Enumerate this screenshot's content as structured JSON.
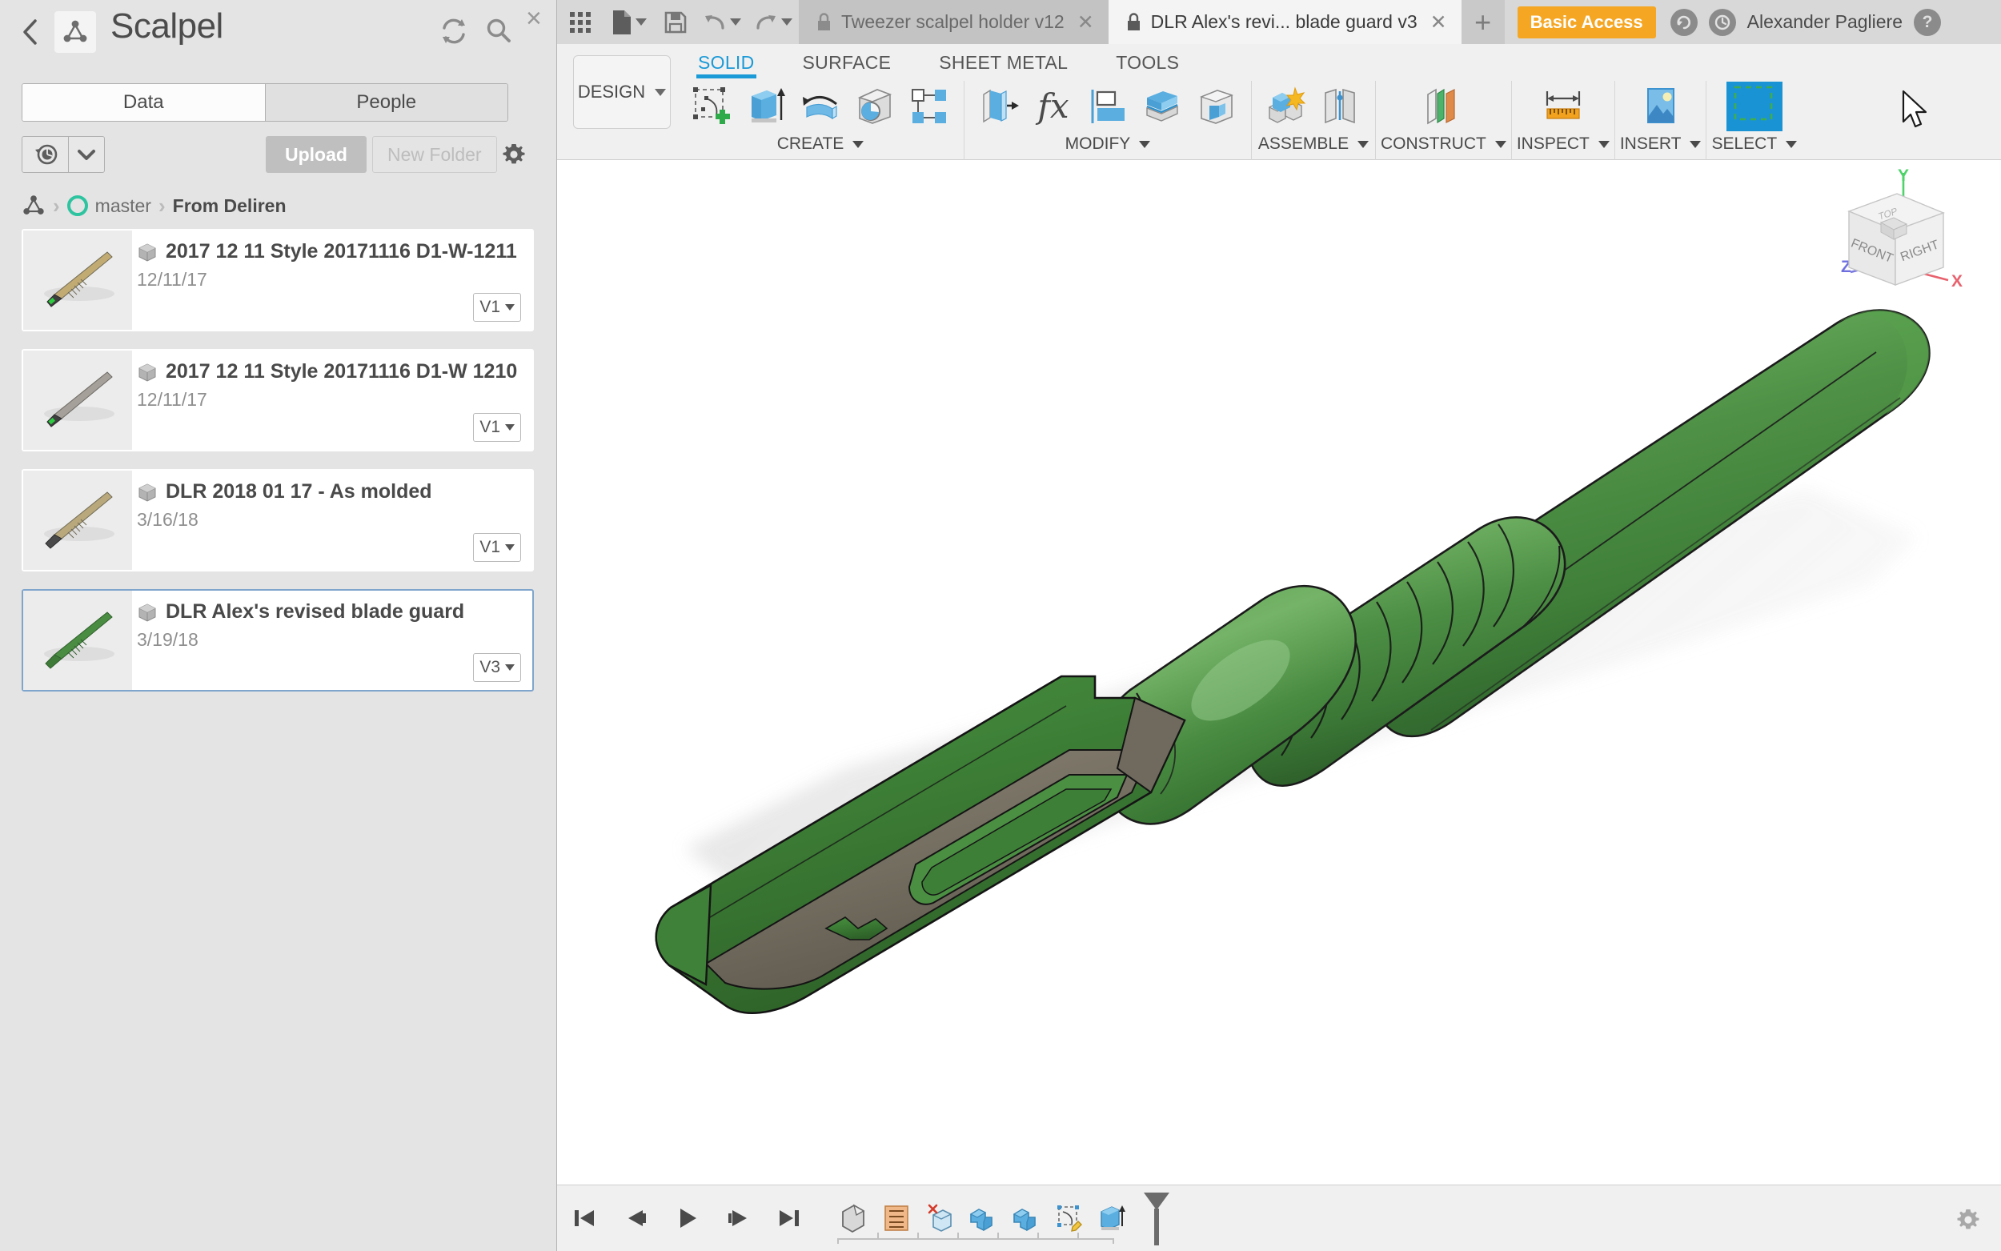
{
  "data_panel": {
    "title": "Scalpel",
    "back_label": "‹",
    "close_label": "×",
    "tabs": [
      {
        "label": "Data",
        "active": true
      },
      {
        "label": "People",
        "active": false
      }
    ],
    "toolbar": {
      "upload_label": "Upload",
      "new_folder_label": "New Folder"
    },
    "breadcrumb": {
      "project_label": "master",
      "folder_label": "From Deliren"
    },
    "items": [
      {
        "name": "2017 12 11 Style 20171116 D1-W-1211",
        "date": "12/11/17",
        "version": "V1",
        "selected": false,
        "thumb_color": "#c2ab73"
      },
      {
        "name": "2017 12 11 Style 20171116 D1-W 1210",
        "date": "12/11/17",
        "version": "V1",
        "selected": false,
        "thumb_color": "#a5a09a"
      },
      {
        "name": "DLR 2018 01 17 - As molded",
        "date": "3/16/18",
        "version": "V1",
        "selected": false,
        "thumb_color": "#b9a87c"
      },
      {
        "name": "DLR Alex's revised blade guard",
        "date": "3/19/18",
        "version": "V3",
        "selected": true,
        "thumb_color": "#4a8c42"
      }
    ]
  },
  "topbar": {
    "doc_tabs": [
      {
        "label": "Tweezer scalpel holder v12",
        "active": false,
        "close": "✕"
      },
      {
        "label": "DLR Alex's revi... blade guard v3",
        "active": true,
        "close": "✕"
      }
    ],
    "new_tab_label": "+",
    "access_badge": "Basic Access",
    "username": "Alexander Pagliere",
    "help_label": "?",
    "notify_label": "↻",
    "jobs_label": "◔"
  },
  "ribbon": {
    "design_label": "DESIGN",
    "tabs": [
      {
        "label": "SOLID",
        "active": true
      },
      {
        "label": "SURFACE",
        "active": false
      },
      {
        "label": "SHEET METAL",
        "active": false
      },
      {
        "label": "TOOLS",
        "active": false
      }
    ],
    "groups": [
      {
        "label": "CREATE",
        "icons": [
          "sketch-icon",
          "extrude-icon",
          "revolve-icon",
          "hole-icon",
          "pattern-icon"
        ]
      },
      {
        "label": "MODIFY",
        "icons": [
          "press-pull-icon",
          "fx-parameters-icon",
          "align-icon",
          "shell-icon",
          "split-body-icon"
        ]
      },
      {
        "label": "ASSEMBLE",
        "icons": [
          "new-component-icon",
          "joint-icon"
        ]
      },
      {
        "label": "CONSTRUCT",
        "icons": [
          "offset-plane-icon"
        ]
      },
      {
        "label": "INSPECT",
        "icons": [
          "measure-icon"
        ]
      },
      {
        "label": "INSERT",
        "icons": [
          "insert-image-icon"
        ]
      },
      {
        "label": "SELECT",
        "icons": [
          "select-window-icon"
        ]
      }
    ]
  },
  "canvas": {
    "viewcube": {
      "front_label": "FRONT",
      "right_label": "RIGHT",
      "top_label": "TOP",
      "axis_x": "X",
      "axis_y": "Y",
      "axis_z": "Z",
      "axis_x_color": "#e8626e",
      "axis_y_color": "#4ed36a",
      "axis_z_color": "#6f6fe0"
    },
    "model": {
      "name": "scalpel-handle-with-blade-guard",
      "body_color": "#4a8c42",
      "body_shade_dark": "#2f5f2c",
      "body_shade_light": "#6aa95f",
      "blade_color": "#7a7466",
      "shadow_color": "#d4d4d4"
    }
  },
  "bottombar": {
    "nav_buttons": [
      "timeline-first",
      "timeline-prev",
      "timeline-play",
      "timeline-next",
      "timeline-last"
    ],
    "timeline_nodes": [
      "base-feature-icon",
      "sketch-list-icon",
      "delete-face-icon",
      "combine-icon",
      "combine2-icon",
      "edit-sketch-icon",
      "extrude-node-icon"
    ],
    "settings_label": "settings-gear"
  }
}
